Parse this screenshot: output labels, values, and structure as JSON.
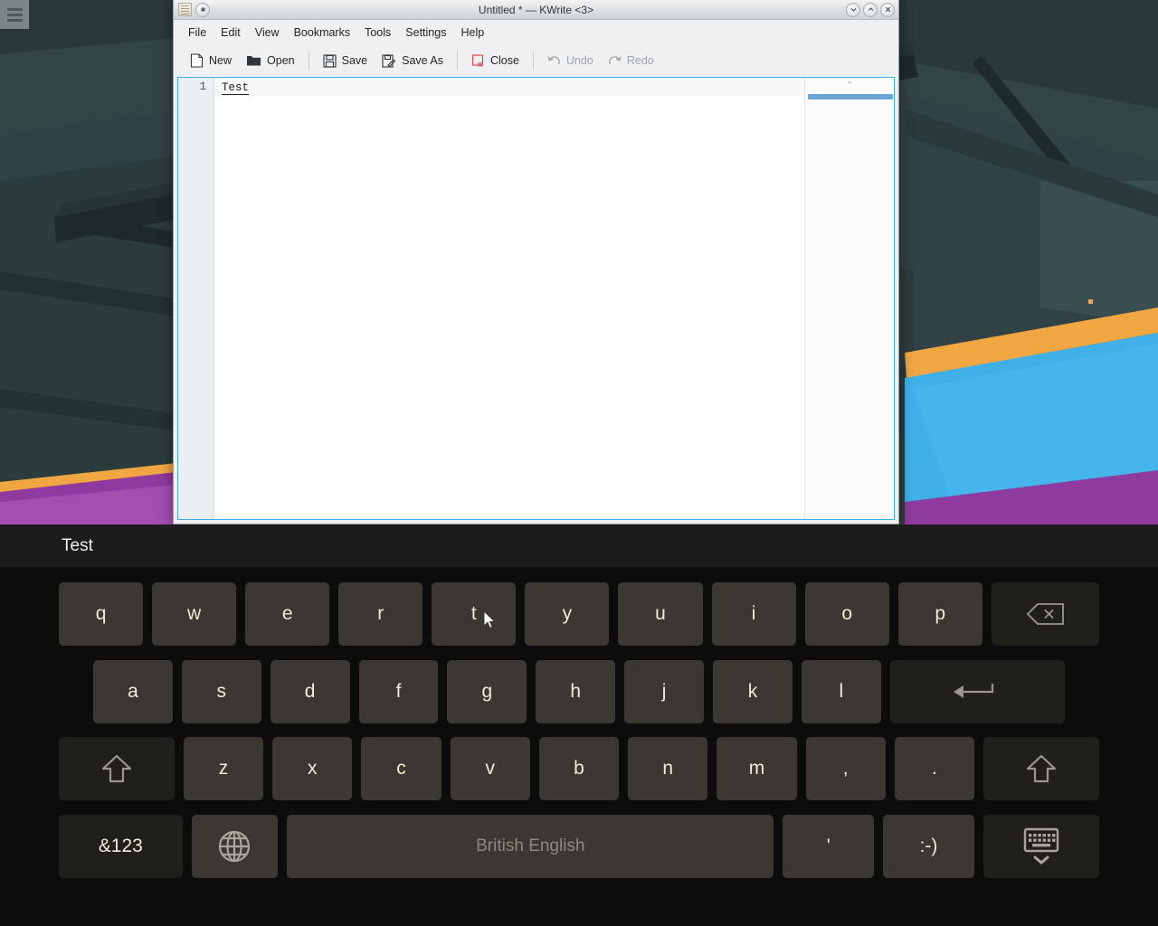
{
  "desktop": {
    "toolbox_label": "desktop-toolbox",
    "wallpaper_colors": {
      "dark_teal": "#2e3c3c",
      "teal_mid": "#35494b",
      "teal_dark": "#1f2b2b",
      "sky_blue": "#3fb0e8",
      "orange": "#f0a641",
      "purple": "#8e3a9e",
      "purple_light": "#a24fb0"
    }
  },
  "window": {
    "title": "Untitled * — KWrite <3>",
    "controls": {
      "pin": "keep-above",
      "minimize": "⌄",
      "maximize": "⌃",
      "close": "✕"
    },
    "menubar": [
      "File",
      "Edit",
      "View",
      "Bookmarks",
      "Tools",
      "Settings",
      "Help"
    ],
    "toolbar": [
      {
        "label": "New",
        "icon": "new-document-icon",
        "enabled": true
      },
      {
        "label": "Open",
        "icon": "folder-open-icon",
        "enabled": true
      },
      {
        "label": "Save",
        "icon": "floppy-save-icon",
        "enabled": true
      },
      {
        "label": "Save As",
        "icon": "save-as-icon",
        "enabled": true
      },
      {
        "label": "Close",
        "icon": "close-document-icon",
        "enabled": true
      },
      {
        "label": "Undo",
        "icon": "undo-arrow-icon",
        "enabled": false
      },
      {
        "label": "Redo",
        "icon": "redo-arrow-icon",
        "enabled": false
      }
    ],
    "editor": {
      "line_number": "1",
      "line_text": "Test"
    }
  },
  "keyboard": {
    "suggestion": "Test",
    "rows": [
      [
        "q",
        "w",
        "e",
        "r",
        "t",
        "y",
        "u",
        "i",
        "o",
        "p",
        "backspace-icon"
      ],
      [
        "a",
        "s",
        "d",
        "f",
        "g",
        "h",
        "j",
        "k",
        "l",
        "enter-icon"
      ],
      [
        "shift-icon",
        "z",
        "x",
        "c",
        "v",
        "b",
        "n",
        "m",
        ",",
        ".",
        "shift-icon"
      ],
      [
        "&123",
        "globe-icon",
        "British English",
        "'",
        ":-)",
        "hide-keyboard-icon"
      ]
    ],
    "space_label": "British English",
    "symbols_label": "&123",
    "apostrophe_label": "'",
    "smiley_label": ":-)",
    "comma_label": ",",
    "period_label": "."
  }
}
